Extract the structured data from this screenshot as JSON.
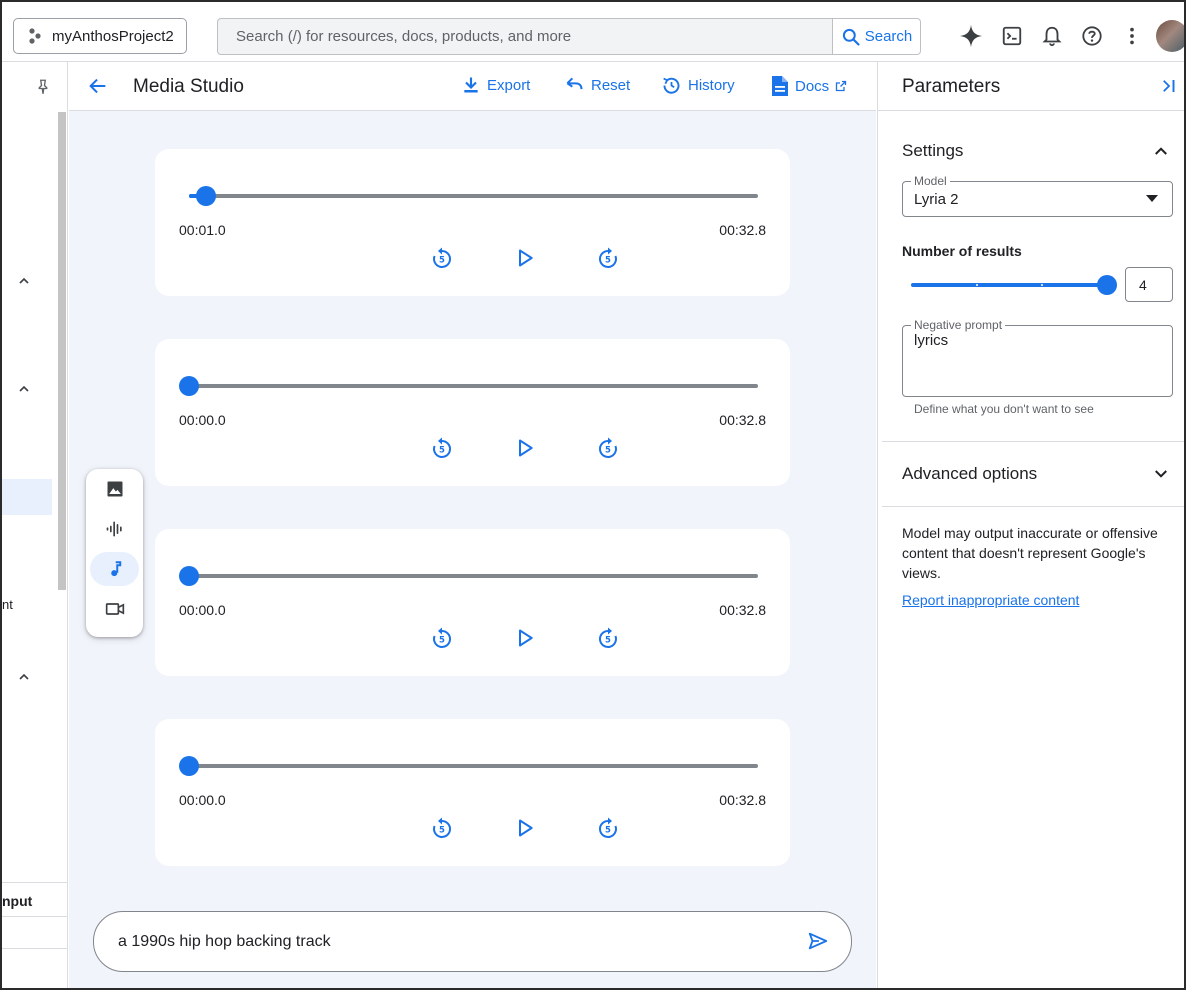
{
  "topbar": {
    "project_name": "myAnthosProject2",
    "search_placeholder": "Search (/) for resources, docs, products, and more",
    "search_button": "Search",
    "icons": [
      "gemini-spark-icon",
      "cloud-shell-icon",
      "notifications-bell-icon",
      "help-icon",
      "more-vert-icon"
    ]
  },
  "leftnav": {
    "partial_labels": [
      "nt",
      "nput"
    ]
  },
  "studio": {
    "title": "Media Studio",
    "actions": {
      "export": "Export",
      "reset": "Reset",
      "history": "History",
      "docs": "Docs"
    }
  },
  "players": [
    {
      "current_time": "00:01.0",
      "duration": "00:32.8",
      "progress": 0.03
    },
    {
      "current_time": "00:00.0",
      "duration": "00:32.8",
      "progress": 0.0
    },
    {
      "current_time": "00:00.0",
      "duration": "00:32.8",
      "progress": 0.0
    },
    {
      "current_time": "00:00.0",
      "duration": "00:32.8",
      "progress": 0.0
    }
  ],
  "media_tools": [
    "image-icon",
    "audio-waveform-icon",
    "music-note-icon",
    "video-icon"
  ],
  "media_tools_active": "music-note-icon",
  "prompt": {
    "value": "a 1990s hip hop backing track"
  },
  "parameters": {
    "title": "Parameters",
    "settings": {
      "title": "Settings",
      "model_label": "Model",
      "model_value": "Lyria 2",
      "num_results_label": "Number of results",
      "num_results_value": "4",
      "num_results_max": 4,
      "negative_prompt_label": "Negative prompt",
      "negative_prompt_value": "lyrics",
      "negative_prompt_hint": "Define what you don't want to see"
    },
    "advanced_title": "Advanced options",
    "disclaimer": "Model may output inaccurate or offensive content that doesn't represent Google's views.",
    "report_link": "Report inappropriate content"
  },
  "colors": {
    "accent": "#1a73e8",
    "canvas_bg": "#f1f4fb",
    "track": "#80868b"
  }
}
